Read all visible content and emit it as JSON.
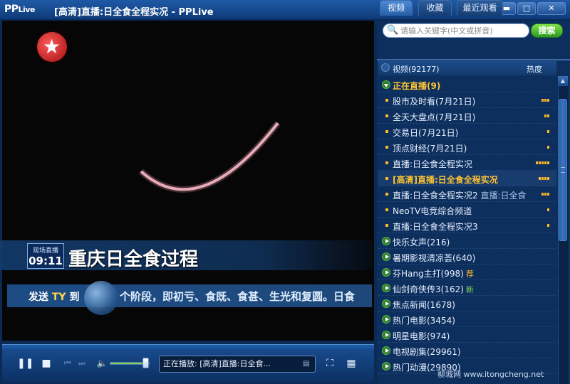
{
  "window": {
    "logo_pp": "PP",
    "logo_live": "Live",
    "title": "[高清]直播:日全食全程实况 - PPLive",
    "buttons": [
      "⇆▾",
      "☰",
      "▬",
      "□",
      "✕"
    ]
  },
  "video": {
    "onair_label": "现场直播",
    "onair_time": "09:11",
    "headline": "重庆日全食过程",
    "ticker_send": "发送",
    "ticker_ty": "TY",
    "ticker_to": "到",
    "ticker_text": "个阶段，即初亏、食既、食甚、生光和复圆。日食"
  },
  "controls": {
    "volume_level": 0.9,
    "now_playing_label": "正在播放:",
    "now_playing_title": "[高清]直播:日全食..."
  },
  "sidebar": {
    "search_placeholder": "请输入关键字(中文或拼音)",
    "search_button": "搜索",
    "tabs": [
      "视频",
      "收藏",
      "最近观看"
    ],
    "list_header": "视频(92177)",
    "sort_label": "热度",
    "live_group": "正在直播(9)",
    "live_items": [
      {
        "title": "股市及时看(7月21日)",
        "heat": 3
      },
      {
        "title": "全天大盘点(7月21日)",
        "heat": 2
      },
      {
        "title": "交易日(7月21日)",
        "heat": 1
      },
      {
        "title": "顶点财经(7月21日)",
        "heat": 1
      },
      {
        "title": "直播:日全食全程实况",
        "heat": 5
      },
      {
        "title": "[高清]直播:日全食全程实况",
        "heat": 4,
        "current": true
      },
      {
        "title": "直播:日全食全程实况2",
        "sub": "直播:日全食",
        "heat": 3
      },
      {
        "title": "NeoTV电竞综合频道",
        "heat": 1
      },
      {
        "title": "直播:日全食全程实况3",
        "heat": 1
      }
    ],
    "groups": [
      {
        "title": "快乐女声(216)"
      },
      {
        "title": "暑期影视清凉荟(640)"
      },
      {
        "title": "芬Hang主打(998)",
        "tag": "荐",
        "tag_type": "rec"
      },
      {
        "title": "仙剑奇侠传3(162)",
        "tag": "新",
        "tag_type": "new"
      },
      {
        "title": "焦点新闻(1678)"
      },
      {
        "title": "热门电影(3454)"
      },
      {
        "title": "明星电影(974)"
      },
      {
        "title": "电视剧集(29961)"
      },
      {
        "title": "热门动漫(29890)"
      }
    ]
  },
  "watermark": "柳城网 www.itongcheng.net"
}
